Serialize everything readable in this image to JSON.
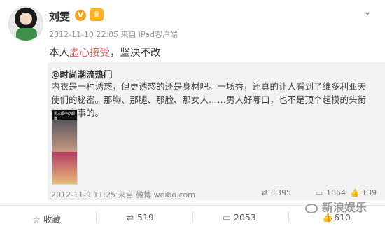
{
  "post": {
    "user": {
      "name": "刘雯",
      "verified_badge": "V"
    },
    "meta": "2012-11-10 22:05 来自 iPad客户端",
    "content": {
      "before": "本人",
      "highlight": "虚心接受",
      "after": "，坚决不改"
    },
    "repost": {
      "original_user": "@时尚潮流热门",
      "original_text": "内衣是一种诱惑，但更诱惑的还是身材吧。一场秀，还真的让人看到了维多利亚天使们的秘密。那胸、那腿、那脸、那女人……男人好哪口，也不是顶个超模的头衔就好办事的。",
      "thumbnail_caption": "男人眼中的超模",
      "original_meta": "2012-11-9 11:25 来自 微博 weibo.com",
      "stats": {
        "reposts": "1395",
        "comments": "1664",
        "likes": "139"
      }
    },
    "actions": {
      "favorite": "收藏",
      "repost": "519",
      "comment": "2053",
      "like": "610"
    }
  },
  "watermark": "新浪娱乐",
  "icons": {
    "menu": "chevron-down-icon",
    "favorite": "star-icon",
    "repost": "repost-icon",
    "comment": "comment-icon",
    "like": "thumbs-up-icon"
  }
}
